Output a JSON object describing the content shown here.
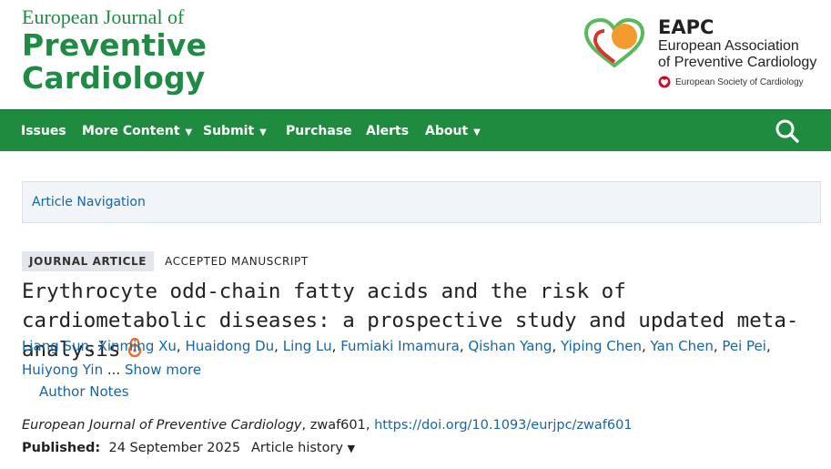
{
  "journal": {
    "line1": "European Journal of",
    "line2": "Preventive",
    "line3": "Cardiology"
  },
  "eapc": {
    "abbr": "EAPC",
    "full_line1": "European Association",
    "full_line2": "of Preventive Cardiology",
    "esc": "European Society of Cardiology",
    "colors": {
      "green": "#5cb85c",
      "orange": "#f39a2e",
      "red": "#d9342b"
    }
  },
  "nav": {
    "items": [
      {
        "label": "Issues",
        "dropdown": false
      },
      {
        "label": "More Content",
        "dropdown": true
      },
      {
        "label": "Submit",
        "dropdown": true
      },
      {
        "label": "Purchase",
        "dropdown": false
      },
      {
        "label": "Alerts",
        "dropdown": false
      },
      {
        "label": "About",
        "dropdown": true
      }
    ],
    "caret": "▼",
    "search_icon": "search-icon",
    "bg_color": "#1e8b3f"
  },
  "article_nav": {
    "label": "Article Navigation"
  },
  "article": {
    "type_badge": "JOURNAL ARTICLE",
    "status": "ACCEPTED MANUSCRIPT",
    "title": "Erythrocyte odd-chain fatty acids and the risk of cardiometabolic diseases: a prospective study and updated meta-analysis",
    "open_access_icon": "open-access-icon",
    "authors": [
      "Liang Sun",
      "Xinming Xu",
      "Huaidong Du",
      "Ling Lu",
      "Fumiaki Imamura",
      "Qishan Yang",
      "Yiping Chen",
      "Yan Chen",
      "Pei Pei",
      "Huiyong Yin"
    ],
    "ellipsis": "...",
    "show_more": "Show more",
    "author_notes": "Author Notes",
    "journal_name": "European Journal of Preventive Cardiology",
    "article_id": ", zwaf601, ",
    "doi": "https://doi.org/10.1093/eurjpc/zwaf601",
    "published_label": "Published:",
    "published_date": "24 September 2025",
    "history_label": "Article history",
    "history_caret": "▼"
  }
}
